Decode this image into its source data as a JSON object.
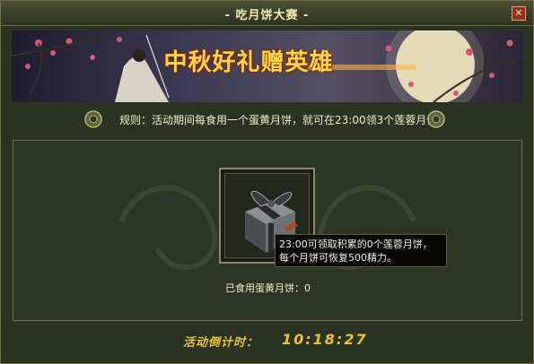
{
  "window": {
    "title": "- 吃月饼大赛 -",
    "close_label": "✕"
  },
  "banner": {
    "title": "中秋好礼赠英雄"
  },
  "rule": {
    "text": "规则：活动期间每食用一个蛋黄月饼，就可在23:00领3个莲蓉月饼"
  },
  "reward_item": {
    "icon": "gift-box-icon",
    "tooltip_line1": "23:00可领取积累的0个莲蓉月饼，",
    "tooltip_line2": "每个月饼可恢复500精力。"
  },
  "status": {
    "eaten_text": "已食用蛋黄月饼：0"
  },
  "countdown": {
    "label": "活动倒计时：",
    "value": "10:18:27"
  },
  "colors": {
    "accent_gold": "#e8c23a",
    "panel_green": "#2d3523",
    "border_gold": "#7b6a3c"
  }
}
